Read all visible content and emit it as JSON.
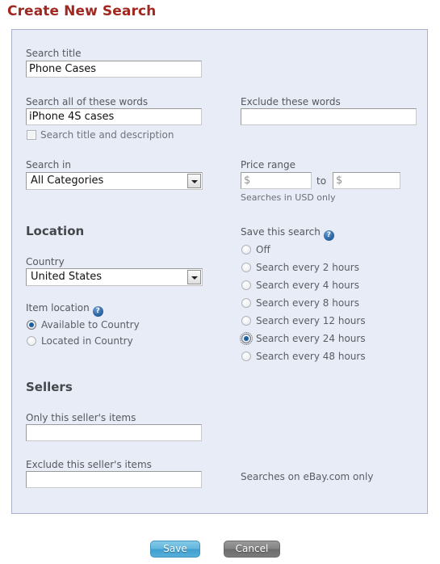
{
  "page": {
    "title": "Create New Search"
  },
  "left": {
    "search_title": {
      "label": "Search title",
      "value": "Phone Cases"
    },
    "search_words": {
      "label": "Search all of these words",
      "value": "iPhone 4S cases"
    },
    "search_title_desc_checkbox": {
      "label": "Search title and description",
      "checked": false
    },
    "search_in": {
      "label": "Search in",
      "selected": "All Categories"
    },
    "location": {
      "heading": "Location",
      "country": {
        "label": "Country",
        "selected": "United States"
      },
      "item_location": {
        "label": "Item location",
        "help_icon": "help-icon",
        "options": [
          {
            "label": "Available to Country",
            "selected": true
          },
          {
            "label": "Located in Country",
            "selected": false
          }
        ]
      }
    },
    "sellers": {
      "heading": "Sellers",
      "only_seller": {
        "label": "Only this seller's items",
        "value": ""
      },
      "exclude_seller": {
        "label": "Exclude this seller's items",
        "value": ""
      }
    }
  },
  "right": {
    "exclude_words": {
      "label": "Exclude these words",
      "value": ""
    },
    "price_range": {
      "label": "Price range",
      "min_placeholder": "$",
      "min_value": "",
      "separator": "to",
      "max_placeholder": "$",
      "max_value": "",
      "hint": "Searches in USD only"
    },
    "save_this_search": {
      "label": "Save this search",
      "help_icon": "help-icon",
      "options": [
        {
          "label": "Off",
          "selected": false
        },
        {
          "label": "Search every 2 hours",
          "selected": false
        },
        {
          "label": "Search every 4 hours",
          "selected": false
        },
        {
          "label": "Search every 8 hours",
          "selected": false
        },
        {
          "label": "Search every 12 hours",
          "selected": false
        },
        {
          "label": "Search every 24 hours",
          "selected": true
        },
        {
          "label": "Search every 48 hours",
          "selected": false
        }
      ]
    },
    "footer_hint": "Searches on eBay.com only"
  },
  "actions": {
    "save_label": "Save",
    "cancel_label": "Cancel"
  },
  "colors": {
    "title": "#a02820",
    "panel_bg": "#e8ecf6",
    "panel_border": "#a8b4c6",
    "save_button": "#4ca3d0",
    "cancel_button": "#7b7b7b",
    "radio_dot": "#1c5f9e",
    "help_icon": "#2f6aa8"
  }
}
